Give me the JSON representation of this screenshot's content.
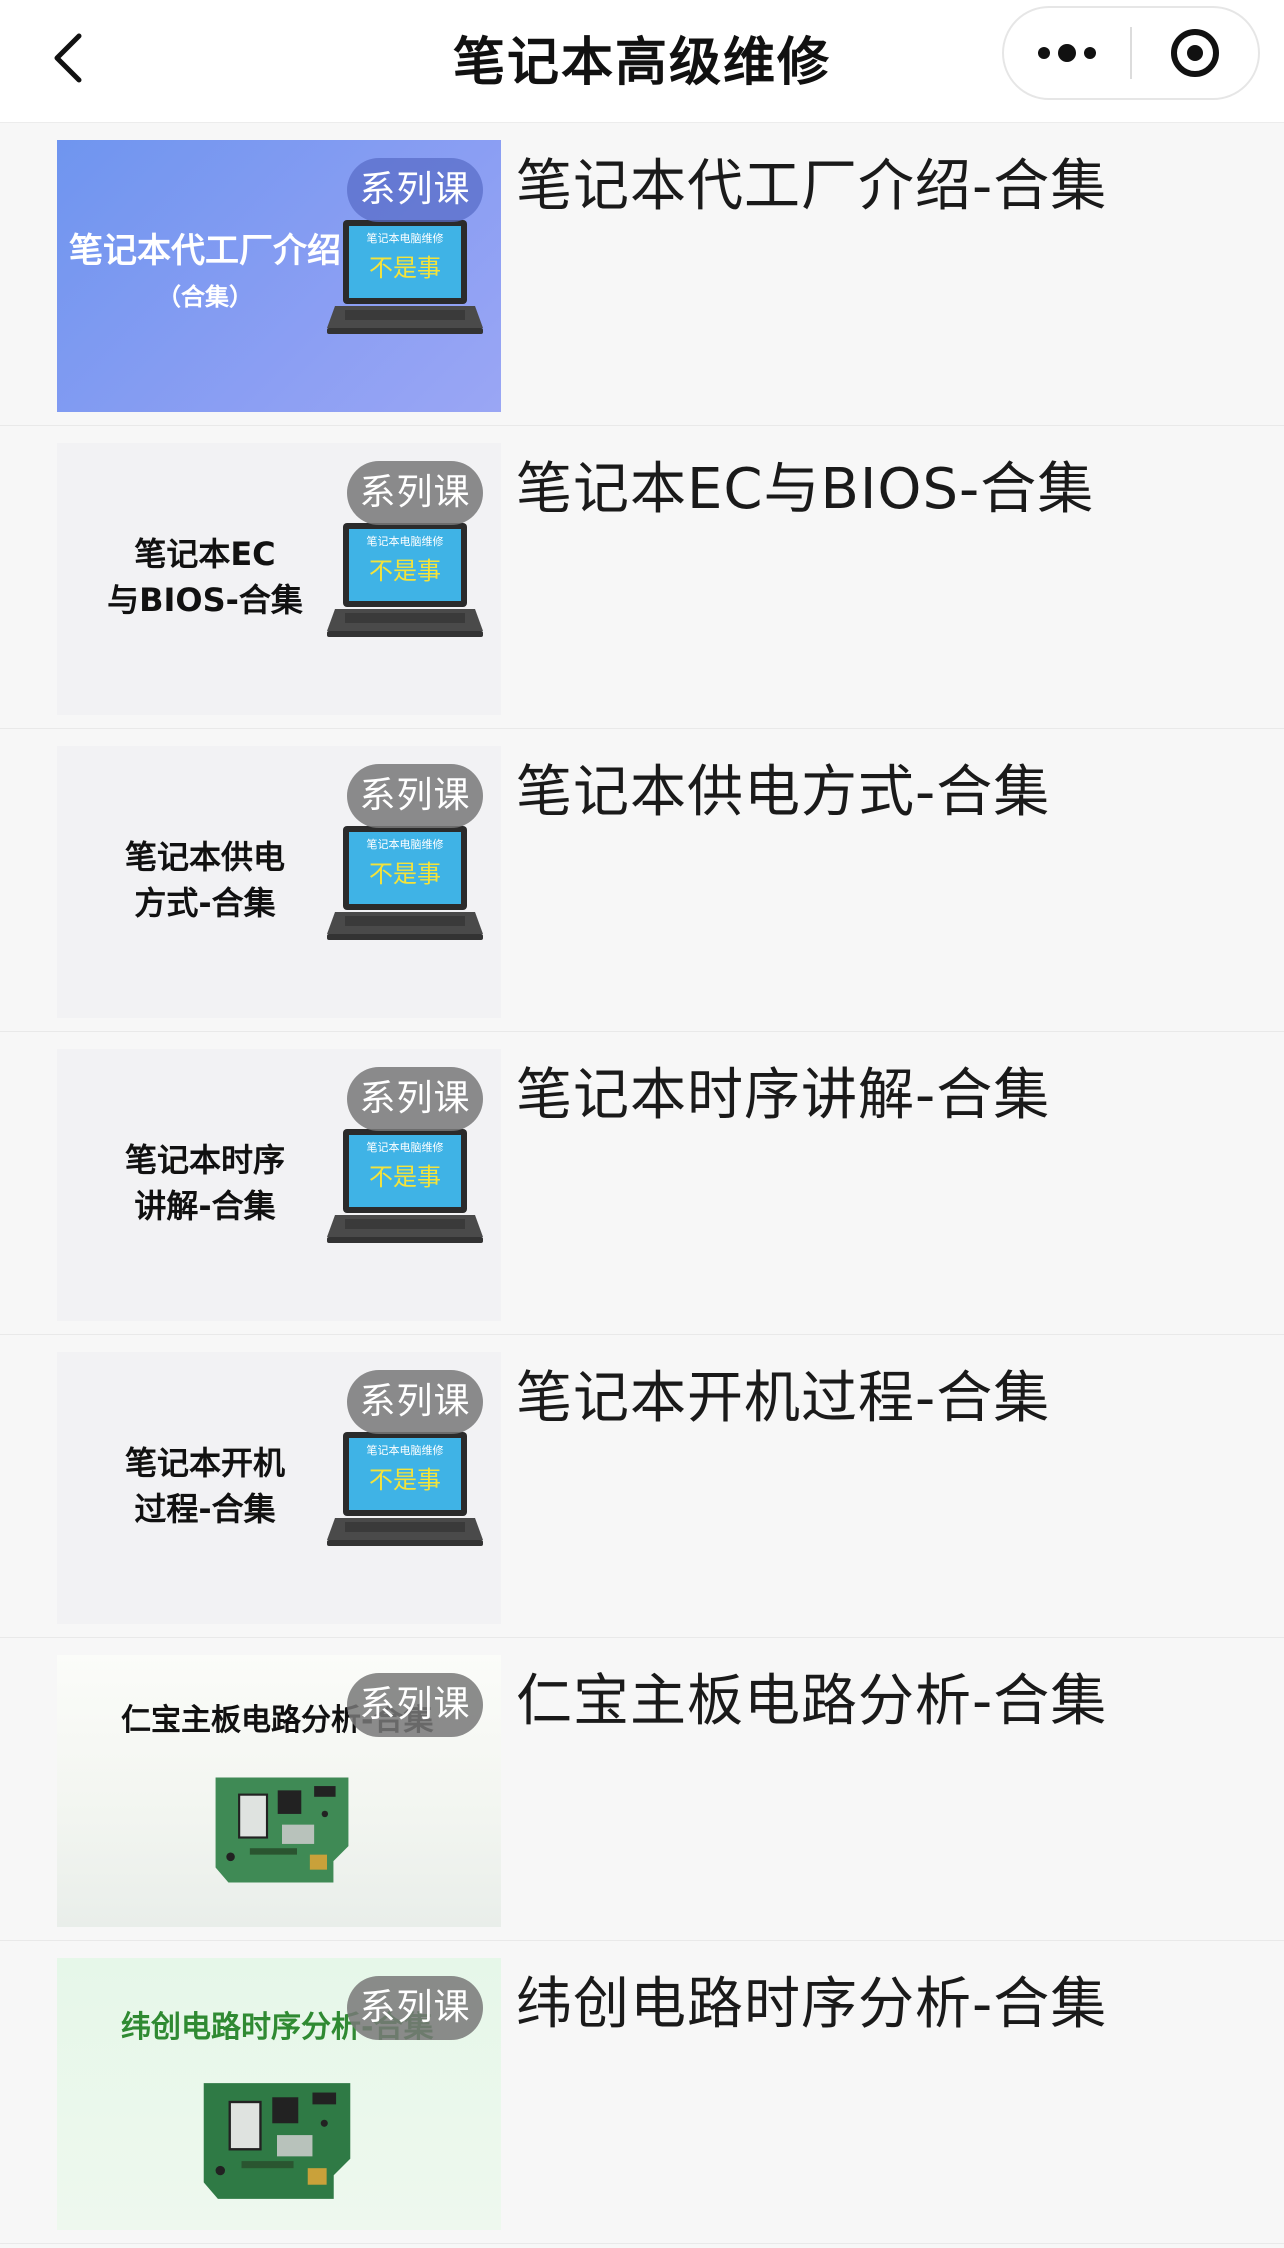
{
  "nav": {
    "title": "笔记本高级维修",
    "back_icon": "chevron-left-icon",
    "more_icon": "more-dots-icon",
    "close_icon": "record-circle-icon"
  },
  "badge_label": "系列课",
  "courses": [
    {
      "title": "笔记本代工厂介绍-合集",
      "cover_lines": [
        "笔记本代工厂介绍",
        "（合集）"
      ],
      "style": "blue"
    },
    {
      "title": "笔记本EC与BIOS-合集",
      "cover_lines": [
        "笔记本EC",
        "与BIOS-合集"
      ],
      "style": "gray"
    },
    {
      "title": "笔记本供电方式-合集",
      "cover_lines": [
        "笔记本供电",
        "方式-合集"
      ],
      "style": "gray"
    },
    {
      "title": "笔记本时序讲解-合集",
      "cover_lines": [
        "笔记本时序",
        "讲解-合集"
      ],
      "style": "gray"
    },
    {
      "title": "笔记本开机过程-合集",
      "cover_lines": [
        "笔记本开机",
        "过程-合集"
      ],
      "style": "gray"
    },
    {
      "title": "仁宝主板电路分析-合集",
      "cover_lines": [
        "仁宝主板电路分析-合集"
      ],
      "style": "pcb1"
    },
    {
      "title": "纬创电路时序分析-合集",
      "cover_lines": [
        "纬创电路时序分析-合集"
      ],
      "style": "pcb2"
    }
  ],
  "laptop_screen_text": "笔记本电脑维修",
  "laptop_screen_slogan": "不是事",
  "colors": {
    "blue_cover": "#7b9af0",
    "badge": "#7d7d7d",
    "pcb_green": "#2f8a32"
  }
}
